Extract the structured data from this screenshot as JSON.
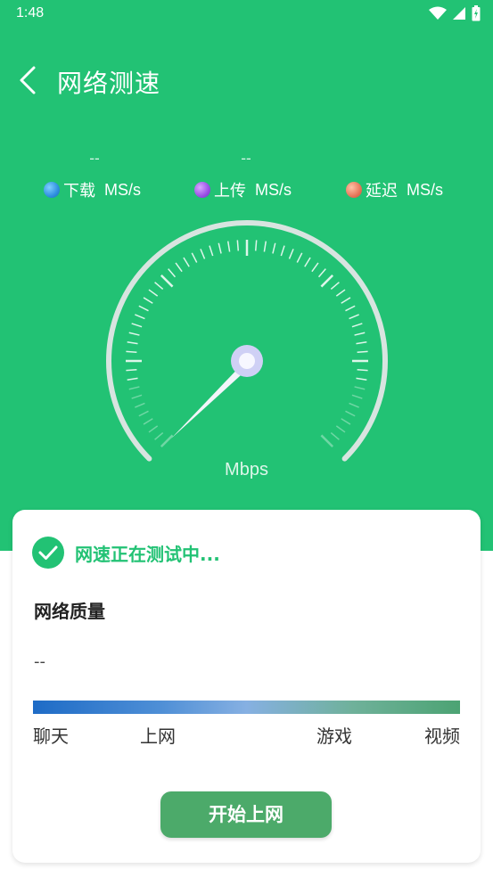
{
  "status_bar": {
    "time": "1:48"
  },
  "header": {
    "title": "网络测速"
  },
  "metrics": [
    {
      "label": "下载",
      "unit": "MS/s",
      "value": "--",
      "color": "#2f8fe0",
      "icon": "download-dot-icon"
    },
    {
      "label": "上传",
      "unit": "MS/s",
      "value": "--",
      "color": "#9b4fe6",
      "icon": "upload-dot-icon"
    },
    {
      "label": "延迟",
      "unit": "MS/s",
      "value": "",
      "color": "#e8765a",
      "icon": "latency-dot-icon"
    }
  ],
  "gauge": {
    "unit": "Mbps"
  },
  "card": {
    "testing_text": "网速正在测试中...",
    "quality_title": "网络质量",
    "quality_value": "--",
    "quality_labels": [
      "聊天",
      "上网",
      "游戏",
      "视频"
    ],
    "start_button": "开始上网"
  },
  "colors": {
    "primary_green": "#22c274",
    "button_green": "#4caa6a"
  }
}
